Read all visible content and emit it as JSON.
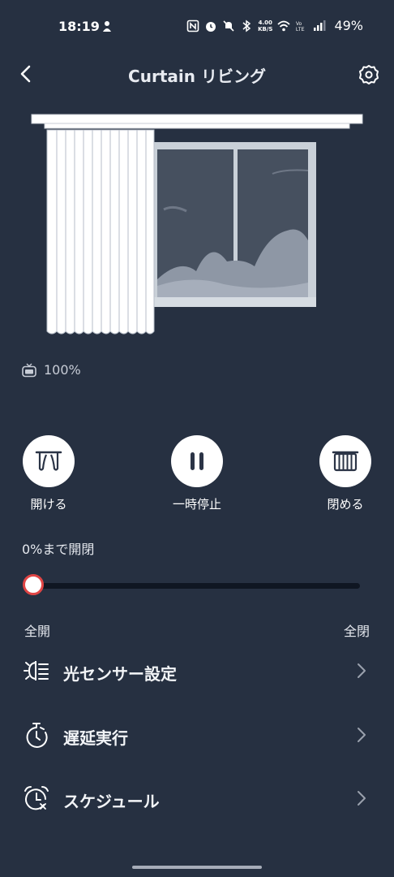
{
  "status_bar": {
    "time": "18:19",
    "data_speed": "4.00\nKB/S",
    "battery": "49%"
  },
  "header": {
    "title": "Curtain リビング"
  },
  "battery": {
    "level": "100%"
  },
  "controls": [
    {
      "label": "開ける",
      "icon": "curtain-open-icon"
    },
    {
      "label": "一時停止",
      "icon": "pause-icon"
    },
    {
      "label": "閉める",
      "icon": "curtain-close-icon"
    }
  ],
  "position": {
    "label": "0%まで開閉",
    "value_percent": 0,
    "min_label": "全開",
    "max_label": "全閉"
  },
  "menu": [
    {
      "label": "光センサー設定",
      "icon": "light-sensor-icon"
    },
    {
      "label": "遅延実行",
      "icon": "timer-icon"
    },
    {
      "label": "スケジュール",
      "icon": "alarm-clock-icon"
    }
  ],
  "colors": {
    "background": "#263041",
    "slider_knob_border": "#e04545",
    "track": "#0f1622"
  }
}
